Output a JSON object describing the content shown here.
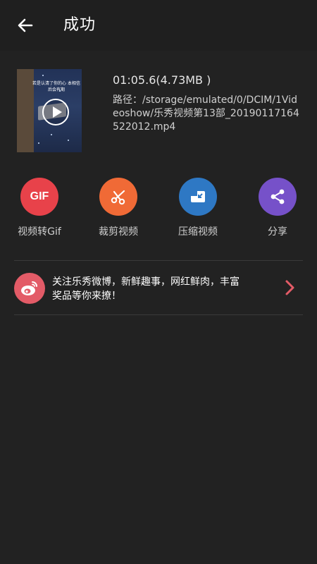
{
  "header": {
    "back_icon": "arrow-left-icon",
    "title": "成功"
  },
  "video": {
    "thumbnail_caption": "若是认清了你的心 本相信后会有期",
    "duration_size": "01:05.6(4.73MB )",
    "path": "路径：/storage/emulated/0/DCIM/1Videoshow/乐秀视频第13部_20190117164522012.mp4"
  },
  "actions": [
    {
      "label": "视频转Gif",
      "icon": "gif-icon",
      "icon_text": "GIF",
      "color": "#e8424a"
    },
    {
      "label": "裁剪视频",
      "icon": "scissors-icon",
      "color": "#f06a36"
    },
    {
      "label": "压缩视频",
      "icon": "compress-icon",
      "color": "#2e78c4"
    },
    {
      "label": "分享",
      "icon": "share-icon",
      "color": "#7651c9"
    }
  ],
  "promo": {
    "icon": "weibo-icon",
    "text": "关注乐秀微博，新鲜趣事，网红鲜肉，丰富奖品等你来撩！",
    "arrow_icon": "chevron-right-icon",
    "accent_color": "#e35b67"
  }
}
